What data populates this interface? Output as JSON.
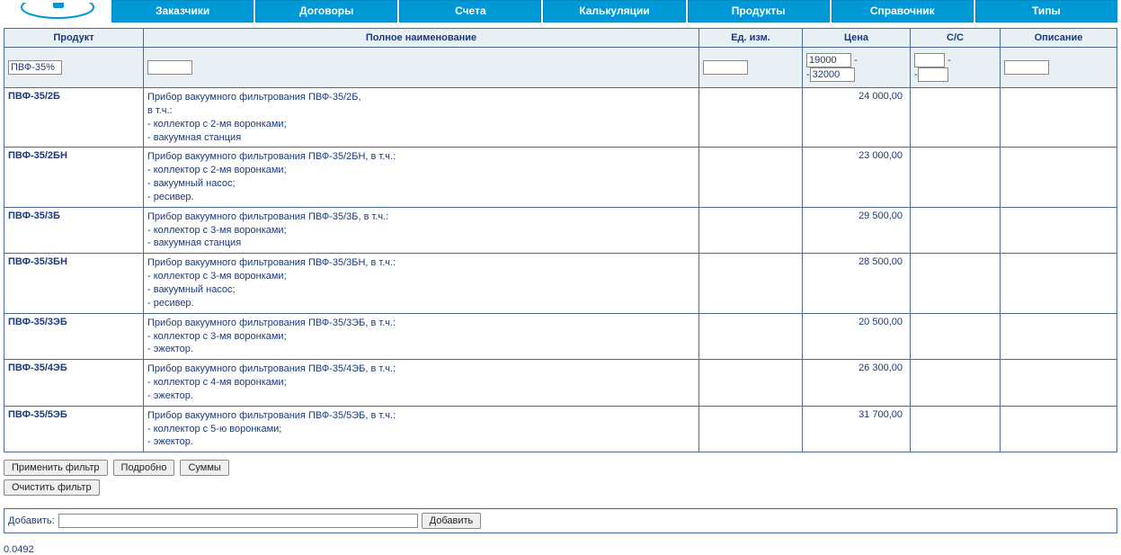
{
  "nav": {
    "items": [
      {
        "label": "Заказчики"
      },
      {
        "label": "Договоры"
      },
      {
        "label": "Счета"
      },
      {
        "label": "Калькуляции"
      },
      {
        "label": "Продукты"
      },
      {
        "label": "Справочник"
      },
      {
        "label": "Типы"
      }
    ]
  },
  "table": {
    "headers": {
      "product": "Продукт",
      "fullname": "Полное наименование",
      "unit": "Ед. изм.",
      "price": "Цена",
      "cc": "С/С",
      "desc": "Описание"
    },
    "filter": {
      "product_value": "ПВФ-35%",
      "fullname_value": "",
      "unit_value": "",
      "price_from": "19000",
      "price_to": "32000",
      "cc_from": "",
      "cc_to": "",
      "desc_value": ""
    },
    "rows": [
      {
        "product": "ПВФ-35/2Б",
        "fullname": "Прибор вакуумного фильтрования ПВФ-35/2Б,\nв т.ч.:\n- коллектор с 2-мя воронками;\n- вакуумная станция",
        "unit": "",
        "price": "24 000,00",
        "cc": "",
        "desc": ""
      },
      {
        "product": "ПВФ-35/2БН",
        "fullname": "Прибор вакуумного фильтрования ПВФ-35/2БН, в т.ч.:\n- коллектор с 2-мя воронками;\n- вакуумный насос;\n- ресивер.",
        "unit": "",
        "price": "23 000,00",
        "cc": "",
        "desc": ""
      },
      {
        "product": "ПВФ-35/3Б",
        "fullname": "Прибор вакуумного фильтрования ПВФ-35/3Б, в т.ч.:\n- коллектор с 3-мя воронками;\n- вакуумная станция",
        "unit": "",
        "price": "29 500,00",
        "cc": "",
        "desc": ""
      },
      {
        "product": "ПВФ-35/3БН",
        "fullname": "Прибор вакуумного фильтрования ПВФ-35/3БН, в т.ч.:\n- коллектор с 3-мя воронками;\n- вакуумный насос;\n- ресивер.",
        "unit": "",
        "price": "28 500,00",
        "cc": "",
        "desc": ""
      },
      {
        "product": "ПВФ-35/3ЭБ",
        "fullname": "Прибор вакуумного фильтрования ПВФ-35/3ЭБ, в т.ч.:\n- коллектор с 3-мя воронками;\n- эжектор.",
        "unit": "",
        "price": "20 500,00",
        "cc": "",
        "desc": ""
      },
      {
        "product": "ПВФ-35/4ЭБ",
        "fullname": "Прибор вакуумного фильтрования ПВФ-35/4ЭБ, в т.ч.:\n- коллектор с 4-мя воронками;\n- эжектор.",
        "unit": "",
        "price": "26 300,00",
        "cc": "",
        "desc": ""
      },
      {
        "product": "ПВФ-35/5ЭБ",
        "fullname": "Прибор вакуумного фильтрования ПВФ-35/5ЭБ, в т.ч.:\n- коллектор с 5-ю воронками;\n- эжектор.",
        "unit": "",
        "price": "31 700,00",
        "cc": "",
        "desc": ""
      }
    ]
  },
  "actions": {
    "apply_filter": "Применить фильтр",
    "details": "Подробно",
    "sums": "Суммы",
    "clear_filter": "Очистить фильтр"
  },
  "add": {
    "label": "Добавить:",
    "value": "",
    "button": "Добавить"
  },
  "timing": "0.0492",
  "range_separator": "-"
}
